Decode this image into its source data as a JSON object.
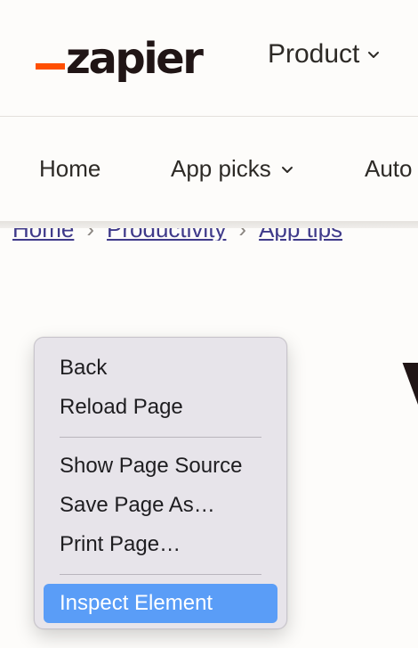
{
  "header": {
    "logo_text": "zapier",
    "product_label": "Product"
  },
  "subnav": {
    "items": [
      {
        "label": "Home"
      },
      {
        "label": "App picks"
      },
      {
        "label": "Auto"
      }
    ]
  },
  "breadcrumb": {
    "items": [
      "Home",
      "Productivity",
      "App tips"
    ],
    "separator": "›"
  },
  "heading": {
    "visible_fragment": "V"
  },
  "context_menu": {
    "groups": [
      [
        "Back",
        "Reload Page"
      ],
      [
        "Show Page Source",
        "Save Page As…",
        "Print Page…"
      ],
      [
        "Inspect Element"
      ]
    ],
    "selected_item": "Inspect Element"
  },
  "colors": {
    "brand_orange": "#ff4f00",
    "menu_highlight": "#5a9df7",
    "link": "#3f3a8a"
  },
  "icons": [
    "chevron-down-icon"
  ]
}
